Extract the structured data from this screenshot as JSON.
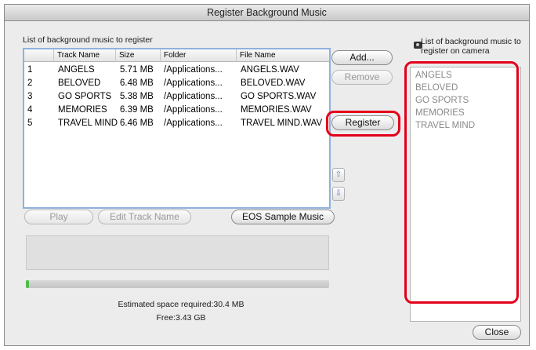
{
  "window": {
    "title": "Register Background Music"
  },
  "left_panel": {
    "list_label": "List of background music to register",
    "columns": [
      "",
      "Track Name",
      "Size",
      "Folder",
      "File Name"
    ],
    "rows": [
      {
        "num": "1",
        "track": "ANGELS",
        "size": "5.71 MB",
        "folder": "/Applications...",
        "file": "ANGELS.WAV"
      },
      {
        "num": "2",
        "track": "BELOVED",
        "size": "6.48 MB",
        "folder": "/Applications...",
        "file": "BELOVED.WAV"
      },
      {
        "num": "3",
        "track": "GO SPORTS",
        "size": "5.38 MB",
        "folder": "/Applications...",
        "file": "GO SPORTS.WAV"
      },
      {
        "num": "4",
        "track": "MEMORIES",
        "size": "6.39 MB",
        "folder": "/Applications...",
        "file": "MEMORIES.WAV"
      },
      {
        "num": "5",
        "track": "TRAVEL MIND",
        "size": "6.46 MB",
        "folder": "/Applications...",
        "file": "TRAVEL MIND.WAV"
      }
    ],
    "play_label": "Play",
    "edit_track_label": "Edit Track Name",
    "eos_sample_label": "EOS Sample Music",
    "progress_fraction": 0.01,
    "estimated_space": "Estimated space required:30.4 MB",
    "free_space": "Free:3.43 GB"
  },
  "middle_buttons": {
    "add_label": "Add...",
    "remove_label": "Remove",
    "register_label": "Register",
    "move_up_icon": "move-up-icon",
    "move_down_icon": "move-down-icon"
  },
  "right_panel": {
    "label_line1": "List of background music to",
    "label_line2": "register on camera",
    "items": [
      "ANGELS",
      "BELOVED",
      "GO SPORTS",
      "MEMORIES",
      "TRAVEL MIND"
    ],
    "close_label": "Close"
  },
  "colors": {
    "highlight": "#e4001b",
    "selection_border": "#8fb1e0",
    "progress": "#4bbd4b"
  }
}
